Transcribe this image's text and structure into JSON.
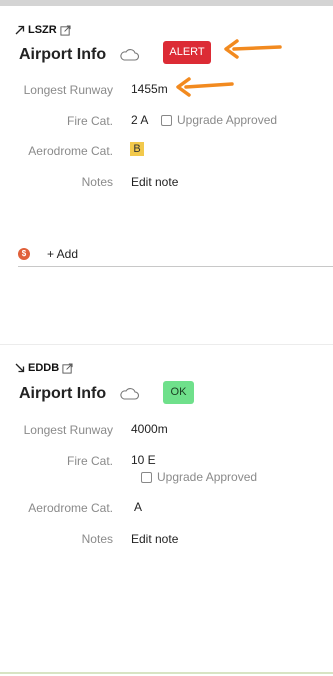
{
  "panels": [
    {
      "code": "LSZR",
      "direction_icon": "arrow-up-right-icon",
      "title": "Airport Info",
      "status": "ALERT",
      "status_color": "#dc2b35",
      "longest_runway_label": "Longest Runway",
      "longest_runway": "1455m",
      "fire_cat_label": "Fire Cat.",
      "fire_cat": "2 A",
      "upgrade_label": "Upgrade Approved",
      "upgrade_checked": false,
      "aerodrome_cat_label": "Aerodrome Cat.",
      "aerodrome_cat": "B",
      "aerodrome_cat_highlight": "#f2c94c",
      "notes_label": "Notes",
      "notes_value": "Edit note",
      "add_label": "+ Add"
    },
    {
      "code": "EDDB",
      "direction_icon": "arrow-down-right-icon",
      "title": "Airport Info",
      "status": "OK",
      "status_color": "#6fe08b",
      "longest_runway_label": "Longest Runway",
      "longest_runway": "4000m",
      "fire_cat_label": "Fire Cat.",
      "fire_cat": "10 E",
      "upgrade_label": "Upgrade Approved",
      "upgrade_checked": false,
      "aerodrome_cat_label": "Aerodrome Cat.",
      "aerodrome_cat": "A",
      "notes_label": "Notes",
      "notes_value": "Edit note"
    }
  ],
  "annotation_color": "#f28a1f"
}
